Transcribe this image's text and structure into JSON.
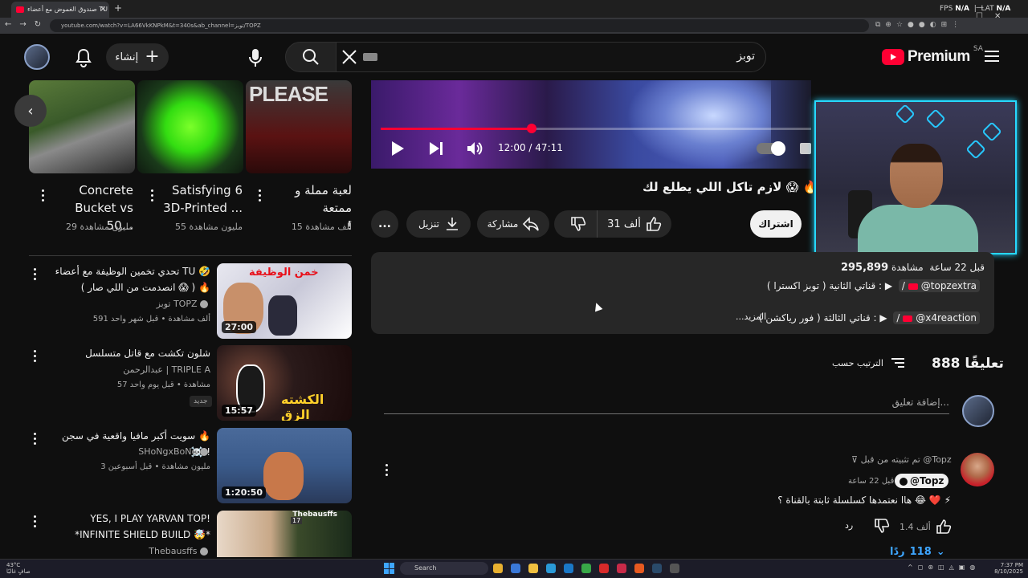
{
  "browser": {
    "tab_title": "صندوق الغموض مع أعضاء TU",
    "url": "youtube.com/watch?v=LA66VkKNPkM&t=340s&ab_channel=توبز/TOPZ",
    "overlay_fps_label": "FPS",
    "overlay_fps_value": "N/A",
    "overlay_lat_label": "LAT",
    "overlay_lat_value": "N/A"
  },
  "header": {
    "create_label": "إنشاء",
    "search_query": "توبز",
    "logo_word": "Premium",
    "logo_region": "SA"
  },
  "shelf": [
    {
      "title_line1": "لعبة مملة و ممتعة",
      "title_line2": "!",
      "meta": "15 ألف مشاهدة",
      "overlay_text": "PLEASE"
    },
    {
      "title_line1": "Satisfying 6",
      "title_line2": "3D-Printed ...",
      "meta": "55 مليون مشاهدة"
    },
    {
      "title_line1": "Concrete",
      "title_line2": "Bucket vs 50...",
      "meta": "29 مليون مشاهدة"
    }
  ],
  "related": [
    {
      "title_line1": "تحدي تخمين الوظيفة مع أعضاء TU 🤣",
      "title_line2": "( انصدمت من اللي صار 😱 ) 🔥",
      "channel": "توبز TOPZ",
      "meta": "591 ألف مشاهدة • قبل شهر واحد",
      "duration": "27:00",
      "thumb_text": "خمن الوظيفة"
    },
    {
      "title_line1": "شلون تكشت مع قاتل متسلسل",
      "title_line2": "",
      "channel": "عبدالرحمن | TRIPLE A",
      "meta": "57 مشاهدة • قبل يوم واحد",
      "duration": "15:57",
      "thumb_text": "الكشته الزق",
      "badge": "جديد"
    },
    {
      "title_line1": "سويت أكبر مافيا واقعية في سجن 🔥 ☠️!!",
      "title_line2": "",
      "channel": "SHoNgxBoNg",
      "meta": "3 مليون مشاهدة • قبل أسبوعين",
      "duration": "1:20:50"
    },
    {
      "title_line1": "YES, I PLAY YARVAN TOP!",
      "title_line2": "*INFINITE SHIELD BUILD 🤯*",
      "channel": "Thebausffs",
      "meta": "",
      "duration": "",
      "thumb_text": "Thebausffs",
      "thumb_level": "17"
    }
  ],
  "player": {
    "time_current": "12:00",
    "time_separator": "/",
    "time_total": "47:11",
    "progress_fraction": 0.35
  },
  "video": {
    "title": "لازم تاكل اللي يطلع لك 😱 🔥",
    "subscribe_label": "اشتراك",
    "like_count": "31 ألف",
    "share_label": "مشاركة",
    "download_label": "تنزيل",
    "more_label": "..."
  },
  "description": {
    "views": "295,899",
    "views_label": "مشاهدة",
    "time_ago": "قبل 22 ساعة",
    "line1_link": "@topzextra",
    "line1_text": "قناتي الثانية ( توبز اكسترا ) :",
    "line2_link": "@x4reaction",
    "line2_text": "قناتي الثالثة ( فور رياكشن ) :",
    "more_label": "...المزيد"
  },
  "comments": {
    "count": "888",
    "count_label": "تعليقًا",
    "sort_label": "الترتيب حسب",
    "add_placeholder": "إضافة تعليق...",
    "pinned_label": "تم تثبيته من قبل @Topz",
    "author": "@Topz",
    "time": "قبل 22 ساعة",
    "text": "هاا نعتمدها كسلسلة ثابتة بالقناة ؟ 😂 ❤️ ⚡",
    "likes": "1.4 ألف",
    "reply_label": "رد",
    "replies_count": "118",
    "replies_label": "ردًا"
  },
  "taskbar": {
    "temp": "43°C",
    "weather": "صافٍ غالبًا",
    "search_label": "Search",
    "time": "7:37 PM",
    "date": "8/10/2025"
  }
}
